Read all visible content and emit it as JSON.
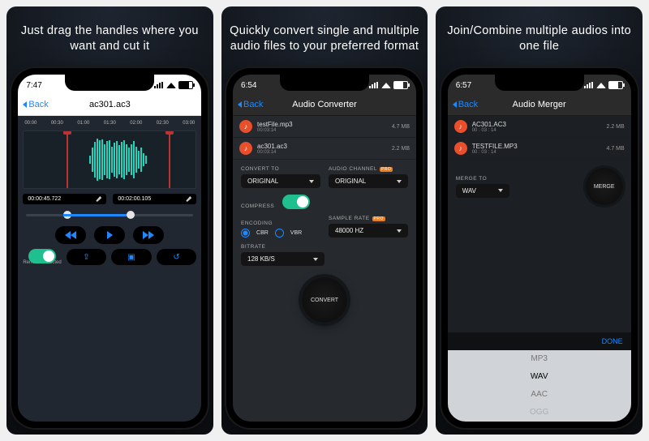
{
  "panels": [
    {
      "tagline": "Just drag the handles where you want and cut it",
      "status_time": "7:47",
      "back_label": "Back",
      "title": "ac301.ac3",
      "timeline_ticks": [
        "00:00",
        "00:30",
        "01:00",
        "01:30",
        "02:00",
        "02:30",
        "03:00"
      ],
      "time_start": "00:00:45.722",
      "time_end": "00:02:00.105",
      "remove_label": "Remove Selected"
    },
    {
      "tagline": "Quickly convert single and multiple audio files to your preferred format",
      "status_time": "6:54",
      "back_label": "Back",
      "title": "Audio Converter",
      "files": [
        {
          "name": "testFile.mp3",
          "dur": "00:03:14",
          "size": "4.7 MB"
        },
        {
          "name": "ac301.ac3",
          "dur": "00:03:14",
          "size": "2.2 MB"
        }
      ],
      "labels": {
        "convert_to": "CONVERT TO",
        "original": "ORIGINAL",
        "audio_channel": "AUDIO CHANNEL",
        "compress": "COMPRESS",
        "encoding": "ENCODING",
        "cbr": "CBR",
        "vbr": "VBR",
        "sample_rate": "SAMPLE RATE",
        "sample_val": "48000 HZ",
        "bitrate": "BITRATE",
        "bitrate_val": "128 KB/S",
        "pro": "PRO",
        "convert_btn": "CONVERT"
      }
    },
    {
      "tagline": "Join/Combine multiple audios into one file",
      "status_time": "6:57",
      "back_label": "Back",
      "title": "Audio Merger",
      "files": [
        {
          "name": "AC301.AC3",
          "dur": "00 : 03 : 14",
          "size": "2.2 MB"
        },
        {
          "name": "TESTFILE.MP3",
          "dur": "00 : 03 : 14",
          "size": "4.7 MB"
        }
      ],
      "labels": {
        "merge_to": "MERGE TO",
        "wav": "WAV",
        "merge": "MERGE",
        "done": "DONE"
      },
      "picker": [
        "MP3",
        "WAV",
        "AAC",
        "OGG"
      ]
    }
  ]
}
